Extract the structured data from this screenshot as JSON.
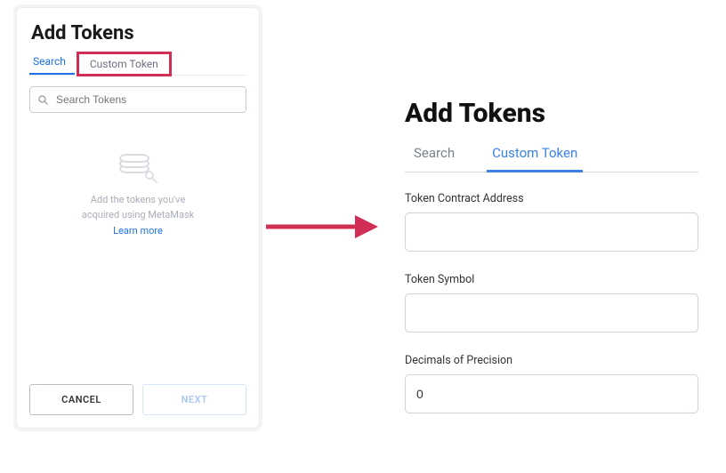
{
  "left": {
    "title": "Add Tokens",
    "tabs": {
      "search": "Search",
      "custom": "Custom Token"
    },
    "search_placeholder": "Search Tokens",
    "empty_text_line1": "Add the tokens you've",
    "empty_text_line2": "acquired using MetaMask",
    "learn_more": "Learn more",
    "cancel": "CANCEL",
    "next": "NEXT"
  },
  "right": {
    "title": "Add Tokens",
    "tabs": {
      "search": "Search",
      "custom": "Custom Token"
    },
    "fields": {
      "address_label": "Token Contract Address",
      "address_value": "",
      "symbol_label": "Token Symbol",
      "symbol_value": "",
      "decimals_label": "Decimals of Precision",
      "decimals_value": "0"
    }
  },
  "colors": {
    "highlight": "#d22d55",
    "link": "#1d72e8"
  }
}
